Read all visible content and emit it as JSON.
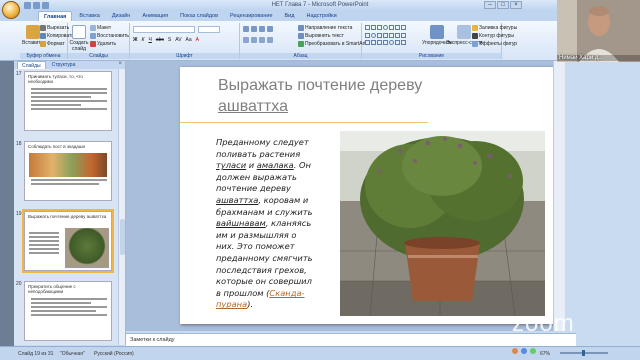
{
  "window": {
    "title": "HET Глава 7 - Microsoft PowerPoint"
  },
  "ribbon": {
    "tabs": [
      "Главная",
      "Вставка",
      "Дизайн",
      "Анимация",
      "Показ слайдов",
      "Рецензирование",
      "Вид",
      "Надстройки"
    ],
    "clipboard": {
      "paste": "Вставить",
      "cut": "Вырезать",
      "copy": "Копировать",
      "format": "Формат",
      "group": "Буфер обмена"
    },
    "slides": {
      "new_slide": "Создать слайд",
      "layout": "Макет",
      "reset": "Восстановить",
      "delete": "Удалить",
      "group": "Слайды"
    },
    "font": {
      "group": "Шрифт"
    },
    "paragraph": {
      "dir": "Направление текста",
      "align": "Выровнять текст",
      "smartart": "Преобразовать в SmartArt",
      "group": "Абзац"
    },
    "drawing": {
      "arrange": "Упорядочить",
      "quick_styles": "Экспресс-стили",
      "fill": "Заливка фигуры",
      "outline": "Контур фигуры",
      "effects": "Эффекты фигур",
      "group": "Рисование"
    },
    "editing": {
      "find": "Найти",
      "replace": "Заменить",
      "select": "Выделить",
      "group": "Редактирование"
    }
  },
  "leftpane": {
    "tabs": [
      "Слайды",
      "Структура"
    ],
    "close": "×",
    "thumbs": [
      {
        "num": "17",
        "title": "Принимать туласи, то, что необходимо"
      },
      {
        "num": "18",
        "title": "Соблюдать пост в экадаши"
      },
      {
        "num": "19",
        "title": "Выражать почтение дереву ашваттха"
      },
      {
        "num": "20",
        "title": "Прекратить общение с неподобающими"
      }
    ]
  },
  "slide": {
    "title_line1": "Выражать почтение дереву",
    "title_line2": "ашваттха",
    "text_a": "Преданному следует поливать растения ",
    "text_tulasi": "туласи",
    "text_b": " и ",
    "text_amalaka": "амалака",
    "text_c": ". Он должен выражать почтение дереву ",
    "text_ashvattha": "ашваттха",
    "text_d": ", коровам и брахманам и служить ",
    "text_vaishnava": "вайшнавам",
    "text_e": ", кланяясь им и размышляя о них. Это поможет преданному смягчить последствия грехов, которые он совершил в прошлом (",
    "text_purana": "Сканда-пурана",
    "text_f": ")."
  },
  "notes": {
    "placeholder": "Заметки к слайду"
  },
  "status": {
    "slide": "Слайд 19 из 31",
    "theme": "\"Обычная\"",
    "lang": "Русский (Россия)",
    "zoom": "67%"
  },
  "zoom": {
    "participant": "Нимай Хари д...",
    "watermark": "zoom"
  }
}
